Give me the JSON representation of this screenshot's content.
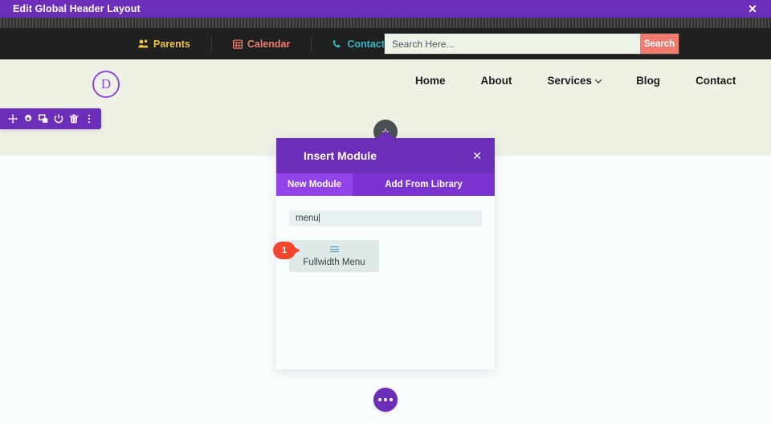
{
  "window": {
    "title": "Edit Global Header Layout",
    "close_label": "✕"
  },
  "utility_bar": {
    "links": [
      {
        "label": "Parents",
        "icon": "users-icon",
        "color": "#f0c23c"
      },
      {
        "label": "Calendar",
        "icon": "calendar-icon",
        "color": "#f07b6e"
      },
      {
        "label": "Contact Us",
        "icon": "phone-icon",
        "color": "#35b6c4"
      }
    ],
    "search": {
      "placeholder": "Search Here...",
      "value": "",
      "button_label": "Search",
      "button_color": "#f07b6e"
    }
  },
  "site_header": {
    "logo_letter": "D",
    "logo_color": "#8c48dd",
    "nav_items": [
      {
        "label": "Home",
        "has_dropdown": false
      },
      {
        "label": "About",
        "has_dropdown": false
      },
      {
        "label": "Services",
        "has_dropdown": true
      },
      {
        "label": "Blog",
        "has_dropdown": false
      },
      {
        "label": "Contact",
        "has_dropdown": false
      }
    ]
  },
  "module_toolbar": {
    "accent": "#6c2eb9",
    "actions": [
      {
        "name": "move-icon",
        "title": "Move"
      },
      {
        "name": "gear-icon",
        "title": "Settings"
      },
      {
        "name": "duplicate-icon",
        "title": "Duplicate"
      },
      {
        "name": "power-icon",
        "title": "Disable"
      },
      {
        "name": "trash-icon",
        "title": "Delete"
      },
      {
        "name": "kebab-icon",
        "title": "More Options"
      }
    ]
  },
  "add_button": {
    "label": "+"
  },
  "insert_module_dialog": {
    "title": "Insert Module",
    "close_label": "✕",
    "header_color": "#6c2eb9",
    "tabs": [
      {
        "label": "New Module",
        "active": true
      },
      {
        "label": "Add From Library",
        "active": false
      }
    ],
    "search": {
      "value": "menu",
      "placeholder": ""
    },
    "results": [
      {
        "label": "Fullwidth Menu",
        "icon": "menu-lines-icon",
        "icon_color": "#5b9ec7"
      }
    ]
  },
  "step_marker": {
    "number": "1",
    "color": "#f4442e"
  },
  "bottom_button": {
    "name": "more-options-button",
    "color": "#6c2eb9"
  }
}
